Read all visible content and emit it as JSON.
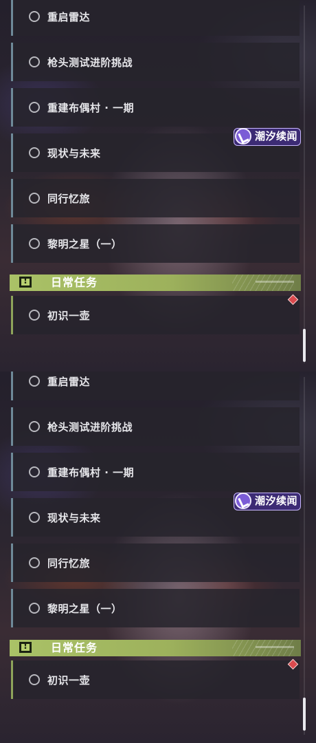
{
  "quests": [
    {
      "title": "重启雷达"
    },
    {
      "title": "枪头测试进阶挑战"
    },
    {
      "title": "重建布偶村 · 一期"
    },
    {
      "title": "现状与未来"
    },
    {
      "title": "同行忆旅"
    },
    {
      "title": "黎明之星（一）"
    }
  ],
  "section": {
    "title": "日常任务",
    "icon": "alert-icon",
    "color": "#aac267"
  },
  "daily_quests": [
    {
      "title": "初识一壶"
    }
  ],
  "badge": {
    "text": "潮汐续闻",
    "icon": "tide-logo-icon",
    "color": "#3c2b74"
  },
  "marker": {
    "icon": "red-diamond-icon",
    "color": "#d94a4e"
  }
}
